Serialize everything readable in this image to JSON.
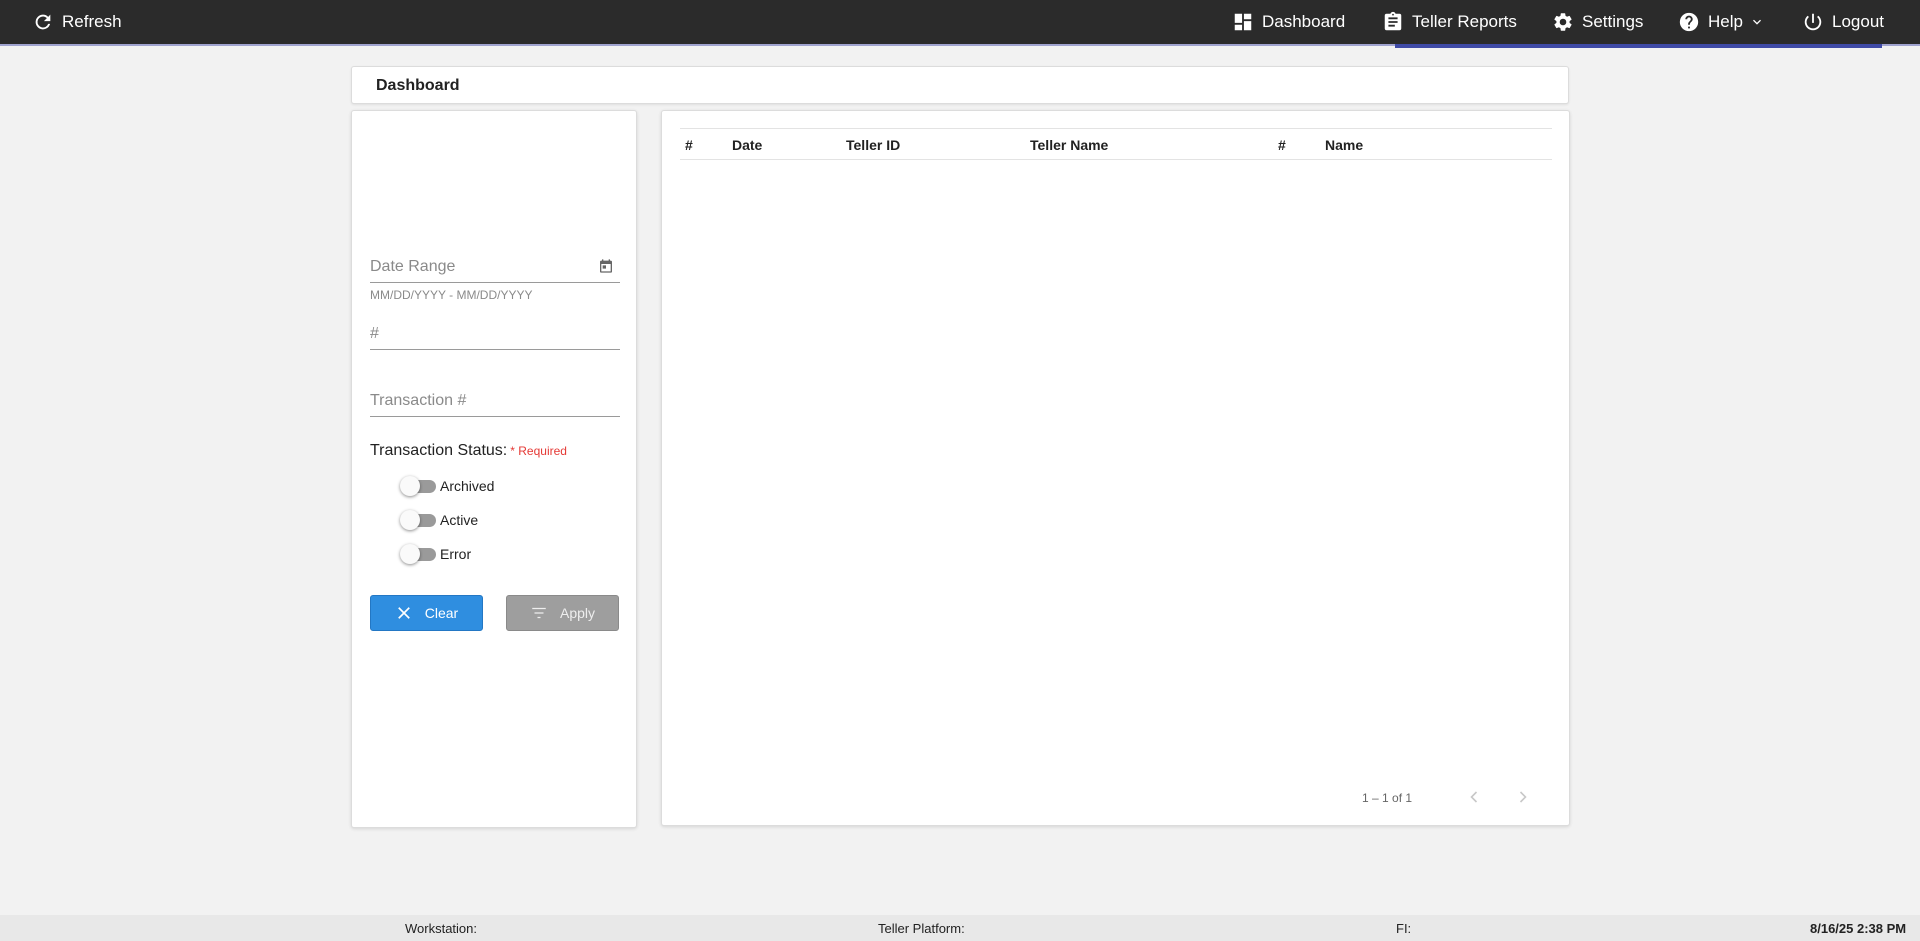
{
  "nav": {
    "refresh": "Refresh",
    "dashboard": "Dashboard",
    "teller_reports": "Teller Reports",
    "settings": "Settings",
    "help": "Help",
    "logout": "Logout"
  },
  "page": {
    "title": "Dashboard"
  },
  "filters": {
    "date_range_label": "Date Range",
    "date_range_hint": "MM/DD/YYYY - MM/DD/YYYY",
    "number_label": "#",
    "transaction_label": "Transaction #",
    "status_label": "Transaction Status:",
    "required_text": "* Required",
    "statuses": [
      "Archived",
      "Active",
      "Error"
    ],
    "clear_label": "Clear",
    "apply_label": "Apply"
  },
  "table": {
    "columns": [
      "#",
      "Date",
      "Teller ID",
      "Teller Name",
      "#",
      "Name"
    ],
    "rows": []
  },
  "pagination": {
    "range_text": "1 – 1 of 1"
  },
  "footer": {
    "workstation": "Workstation:",
    "teller_platform": "Teller Platform:",
    "fi": "FI:",
    "datetime": "8/16/25 2:38 PM"
  },
  "colors": {
    "topbar": "#2b2b2b",
    "accent": "#3f4aa6",
    "primary_button": "#2f8ee0",
    "disabled_button": "#9e9e9e",
    "required": "#e53935"
  }
}
